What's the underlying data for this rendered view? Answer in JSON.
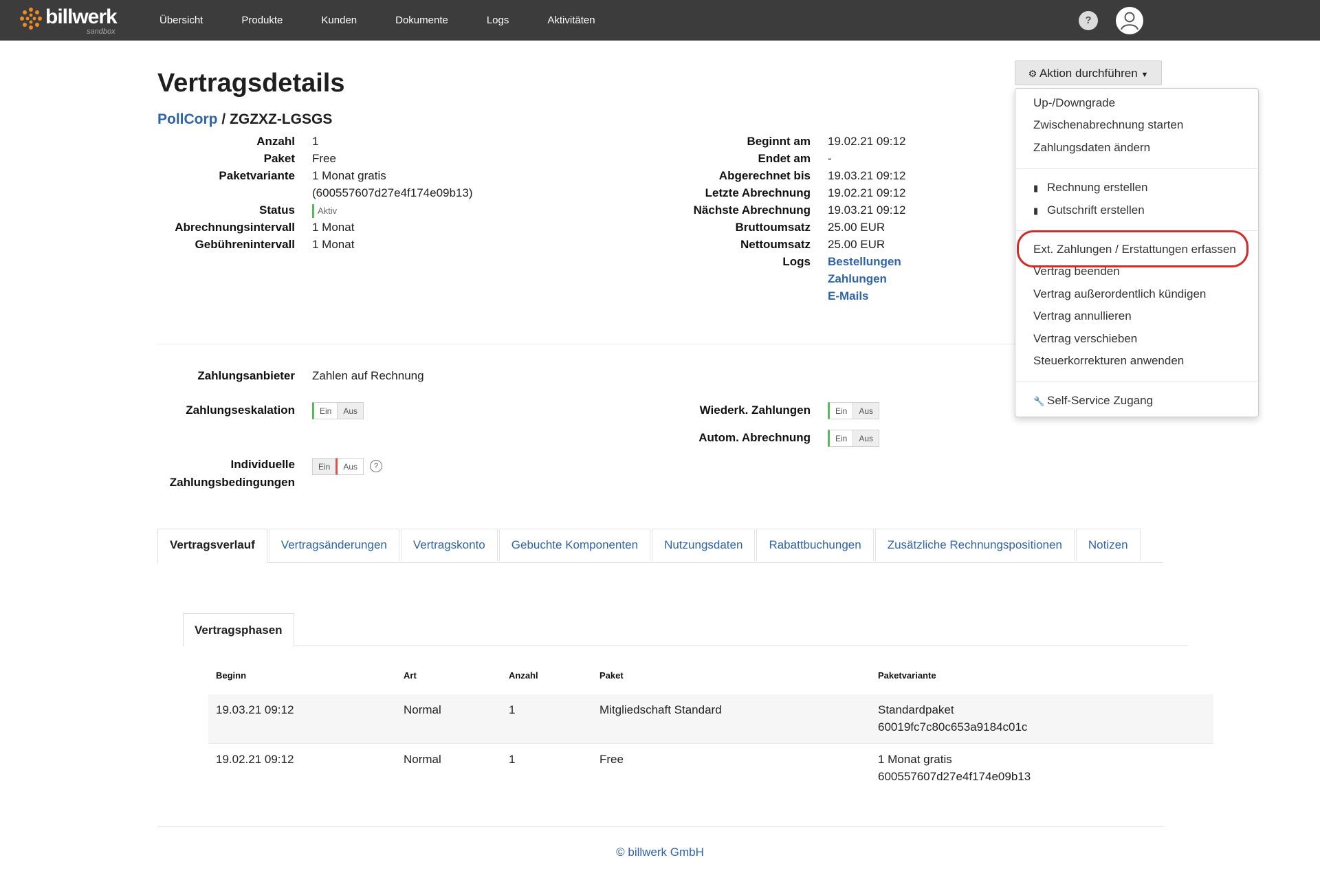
{
  "header": {
    "logo_text": "billwerk",
    "logo_sub": "sandbox",
    "nav": [
      "Übersicht",
      "Produkte",
      "Kunden",
      "Dokumente",
      "Logs",
      "Aktivitäten"
    ],
    "help": "?"
  },
  "page": {
    "title": "Vertragsdetails",
    "customer_link": "PollCorp",
    "separator": "/",
    "contract_code": "ZGZXZ-LGSGS"
  },
  "details_left": {
    "anzahl_label": "Anzahl",
    "anzahl": "1",
    "paket_label": "Paket",
    "paket": "Free",
    "variante_label": "Paketvariante",
    "variante_1": "1 Monat gratis",
    "variante_2": "(600557607d27e4f174e09b13)",
    "status_label": "Status",
    "status": "Aktiv",
    "abrechnungsintervall_label": "Abrechnungsintervall",
    "abrechnungsintervall": "1 Monat",
    "gebuehrenintervall_label": "Gebührenintervall",
    "gebuehrenintervall": "1 Monat"
  },
  "details_right": {
    "beginnt_label": "Beginnt am",
    "beginnt": "19.02.21 09:12",
    "endet_label": "Endet am",
    "endet": "-",
    "abgerechnet_label": "Abgerechnet bis",
    "abgerechnet": "19.03.21 09:12",
    "letzte_label": "Letzte Abrechnung",
    "letzte": "19.02.21 09:12",
    "naechste_label": "Nächste Abrechnung",
    "naechste": "19.03.21 09:12",
    "brutto_label": "Bruttoumsatz",
    "brutto": "25.00 EUR",
    "netto_label": "Nettoumsatz",
    "netto": "25.00 EUR",
    "logs_label": "Logs",
    "logs_links": [
      "Bestellungen",
      "Zahlungen",
      "E-Mails"
    ]
  },
  "payment": {
    "anbieter_label": "Zahlungsanbieter",
    "anbieter": "Zahlen auf Rechnung",
    "eskalation_label": "Zahlungseskalation",
    "individuelle_label_1": "Individuelle",
    "individuelle_label_2": "Zahlungsbedingungen",
    "wiederk_label": "Wiederk. Zahlungen",
    "autom_label": "Autom. Abrechnung",
    "ein": "Ein",
    "aus": "Aus",
    "help": "?"
  },
  "tabs": [
    "Vertragsverlauf",
    "Vertragsänderungen",
    "Vertragskonto",
    "Gebuchte Komponenten",
    "Nutzungsdaten",
    "Rabattbuchungen",
    "Zusätzliche Rechnungspositionen",
    "Notizen"
  ],
  "subtab": "Vertragsphasen",
  "table": {
    "headers": [
      "Beginn",
      "Art",
      "Anzahl",
      "Paket",
      "Paketvariante"
    ],
    "rows": [
      {
        "beginn": "19.03.21 09:12",
        "art": "Normal",
        "anzahl": "1",
        "paket": "Mitgliedschaft Standard",
        "variante_1": "Standardpaket",
        "variante_2": "60019fc7c80c653a9184c01c"
      },
      {
        "beginn": "19.02.21 09:12",
        "art": "Normal",
        "anzahl": "1",
        "paket": "Free",
        "variante_1": "1 Monat gratis",
        "variante_2": "600557607d27e4f174e09b13"
      }
    ]
  },
  "footer": "© billwerk GmbH",
  "action": {
    "button": "Aktion durchführen",
    "items": [
      "Up-/Downgrade",
      "Zwischenabrechnung starten",
      "Zahlungsdaten ändern",
      "Rechnung erstellen",
      "Gutschrift erstellen",
      "Ext. Zahlungen / Erstattungen erfassen",
      "Vertrag beenden",
      "Vertrag außerordentlich kündigen",
      "Vertrag annullieren",
      "Vertrag verschieben",
      "Steuerkorrekturen anwenden",
      "Self-Service Zugang"
    ]
  },
  "colors": {
    "topbar": "#3c3c3c",
    "link": "#2f64a8",
    "active_green": "#5cb85c",
    "inactive_red": "#d9534f",
    "highlight": "#d42a2a",
    "logo_orange": "#f08a24"
  }
}
